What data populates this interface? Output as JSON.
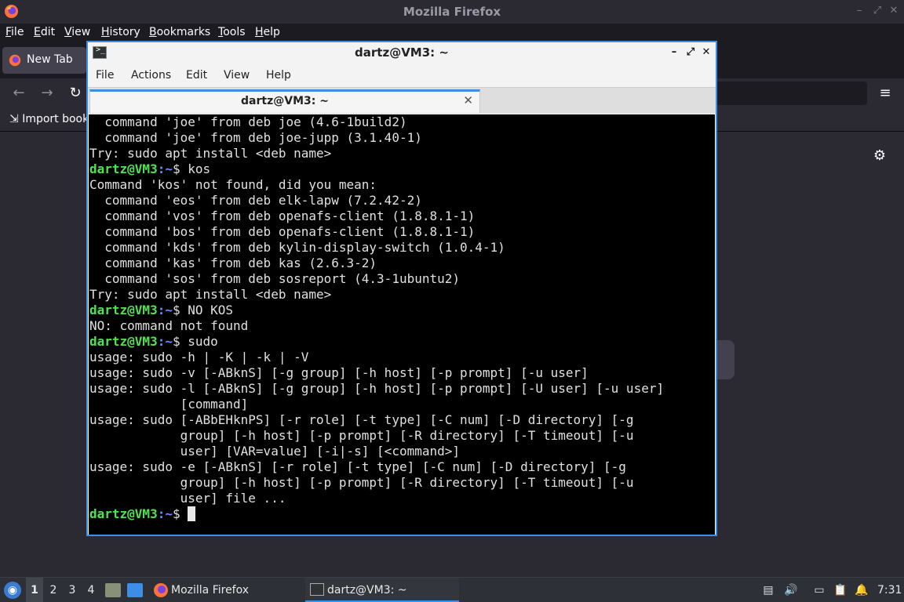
{
  "firefox": {
    "title": "Mozilla Firefox",
    "menu": [
      "File",
      "Edit",
      "View",
      "History",
      "Bookmarks",
      "Tools",
      "Help"
    ],
    "tab_label": "New Tab",
    "import_bookmarks": "Import book"
  },
  "terminal": {
    "title": "dartz@VM3: ~",
    "menu": [
      "File",
      "Actions",
      "Edit",
      "View",
      "Help"
    ],
    "tab_title": "dartz@VM3: ~",
    "prompt_user": "dartz@VM3",
    "prompt_path": ":~",
    "lines": [
      {
        "text": "  command 'joe' from deb joe (4.6-1build2)"
      },
      {
        "text": "  command 'joe' from deb joe-jupp (3.1.40-1)"
      },
      {
        "text": "Try: sudo apt install <deb name>"
      },
      {
        "prompt": true,
        "text": "$ kos"
      },
      {
        "text": "Command 'kos' not found, did you mean:"
      },
      {
        "text": "  command 'eos' from deb elk-lapw (7.2.42-2)"
      },
      {
        "text": "  command 'vos' from deb openafs-client (1.8.8.1-1)"
      },
      {
        "text": "  command 'bos' from deb openafs-client (1.8.8.1-1)"
      },
      {
        "text": "  command 'kds' from deb kylin-display-switch (1.0.4-1)"
      },
      {
        "text": "  command 'kas' from deb kas (2.6.3-2)"
      },
      {
        "text": "  command 'sos' from deb sosreport (4.3-1ubuntu2)"
      },
      {
        "text": "Try: sudo apt install <deb name>"
      },
      {
        "prompt": true,
        "text": "$ NO KOS"
      },
      {
        "text": "NO: command not found"
      },
      {
        "prompt": true,
        "text": "$ sudo"
      },
      {
        "text": "usage: sudo -h | -K | -k | -V"
      },
      {
        "text": "usage: sudo -v [-ABknS] [-g group] [-h host] [-p prompt] [-u user]"
      },
      {
        "text": "usage: sudo -l [-ABknS] [-g group] [-h host] [-p prompt] [-U user] [-u user]"
      },
      {
        "text": "            [command]"
      },
      {
        "text": "usage: sudo [-ABbEHknPS] [-r role] [-t type] [-C num] [-D directory] [-g"
      },
      {
        "text": "            group] [-h host] [-p prompt] [-R directory] [-T timeout] [-u"
      },
      {
        "text": "            user] [VAR=value] [-i|-s] [<command>]"
      },
      {
        "text": "usage: sudo -e [-ABknS] [-r role] [-t type] [-C num] [-D directory] [-g"
      },
      {
        "text": "            group] [-h host] [-p prompt] [-R directory] [-T timeout] [-u"
      },
      {
        "text": "            user] file ..."
      },
      {
        "prompt": true,
        "text": "$ ",
        "cursor": true
      }
    ]
  },
  "taskbar": {
    "workspaces": [
      "1",
      "2",
      "3",
      "4"
    ],
    "active_workspace": 0,
    "tasks": [
      "Mozilla Firefox",
      "dartz@VM3: ~"
    ],
    "clock": "7:31"
  },
  "colors": {
    "prompt_user": "#4fe34f",
    "prompt_path": "#6d8bff",
    "accent": "#3d8ee6"
  }
}
